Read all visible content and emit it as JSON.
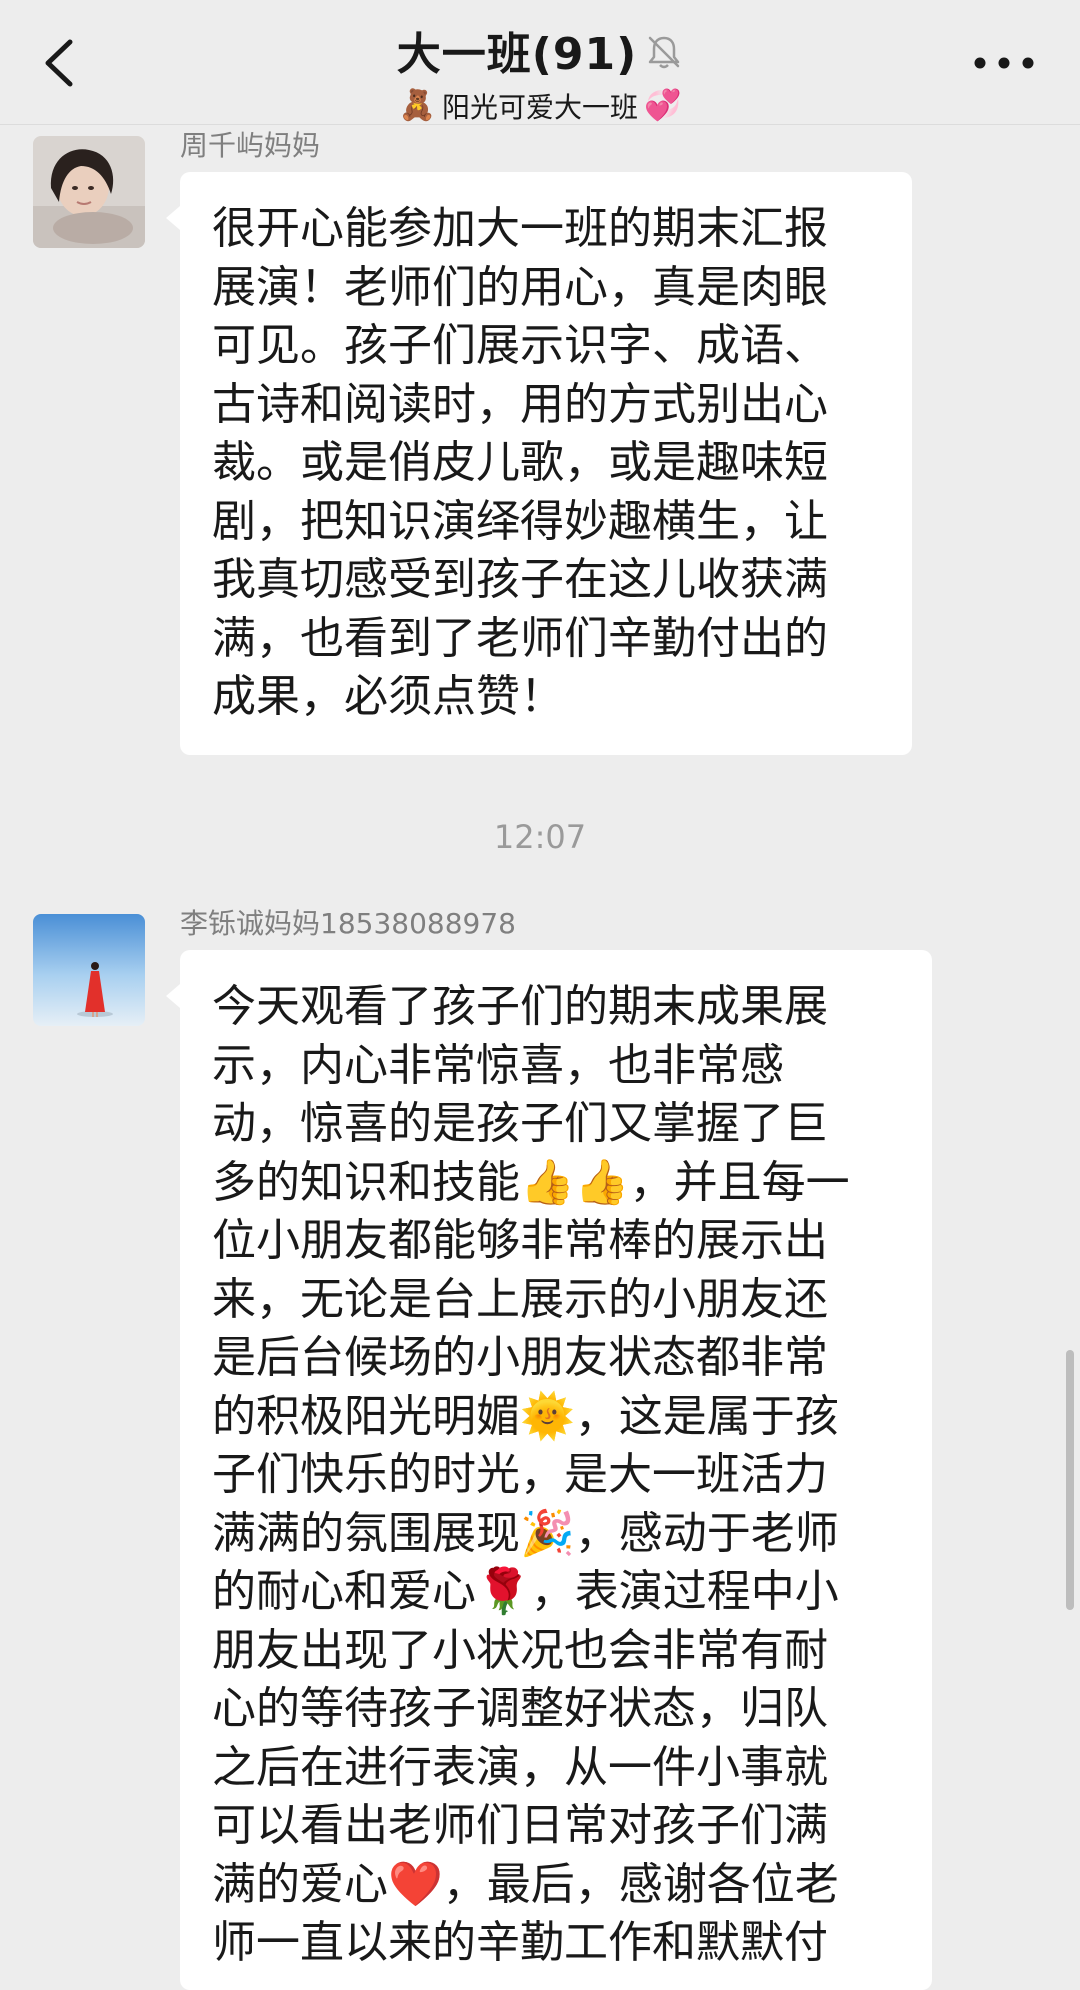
{
  "header": {
    "title": "大一班(91)",
    "subtitle": "阳光可爱大一班",
    "back_icon": "chevron-left-icon",
    "mute_icon": "bell-muted-icon",
    "more_icon": "more-dots-icon",
    "subtitle_left_emoji": "🧸",
    "subtitle_right_emoji": "💞"
  },
  "messages": [
    {
      "sender": "周千屿妈妈",
      "text": "很开心能参加大一班的期末汇报\n展演！老师们的用心，真是肉眼\n可见。孩子们展示识字、成语、\n古诗和阅读时，用的方式别出心\n裁。或是俏皮儿歌，或是趣味短\n剧，把知识演绎得妙趣横生，让\n我真切感受到孩子在这儿收获满\n满，也看到了老师们辛勤付出的\n成果，必须点赞！"
    },
    {
      "sender": "李铄诚妈妈18538088978",
      "text": "今天观看了孩子们的期末成果展\n示，内心非常惊喜，也非常感\n动，惊喜的是孩子们又掌握了巨\n多的知识和技能👍👍，并且每一\n位小朋友都能够非常棒的展示出\n来，无论是台上展示的小朋友还\n是后台候场的小朋友状态都非常\n的积极阳光明媚🌞，这是属于孩\n子们快乐的时光，是大一班活力\n满满的氛围展现🎉，感动于老师\n的耐心和爱心🌹，表演过程中小\n朋友出现了小状况也会非常有耐\n心的等待孩子调整好状态，归队\n之后在进行表演，从一件小事就\n可以看出老师们日常对孩子们满\n满的爱心❤️，最后，感谢各位老\n师一直以来的辛勤工作和默默付"
    }
  ],
  "timestamp": "12:07",
  "colors": {
    "background": "#ededed",
    "bubble": "#ffffff",
    "sender_text": "#7f7f7f",
    "timestamp_text": "#9a9a9a"
  }
}
